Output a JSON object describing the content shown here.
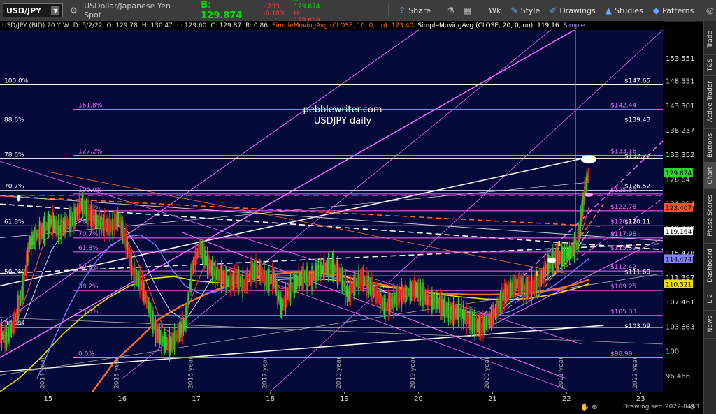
{
  "toolbar": {
    "symbol": "USD/JPY",
    "description": "USDollar/Japanese Yen Spot",
    "bid": "B: 129.874",
    "change_abs": "-.233",
    "change_pct": "-0.18%",
    "ask": "A: 129.874",
    "high_small": "H: 129.889",
    "buttons": {
      "share": "Share",
      "timeframe": "Wk",
      "style": "Style",
      "drawings": "Drawings",
      "studies": "Studies",
      "patterns": "Patterns"
    }
  },
  "infobar": {
    "symbol": "USD/JPY (BID) 20 Y W",
    "date": "D: 5/2/22",
    "open": "O: 129.78",
    "high": "H: 130.47",
    "low": "L: 129.60",
    "close": "C: 129.87",
    "range": "R: 0.86",
    "sma1": "SimpleMovingAvg (CLOSE, 10, 0, no)",
    "sma1_val": "123.40",
    "sma2": "SimpleMovingAvg (CLOSE, 20, 0, no)",
    "sma2_val": "119.16",
    "sma3": "Simple..."
  },
  "side_tabs": [
    "Trade",
    "T&S",
    "Active Trader",
    "Buttons",
    "Chart",
    "Phase Scores",
    "Dashboard",
    "L 2",
    "News"
  ],
  "statusbar": {
    "drawing_set": "Drawing set: 2022-0418"
  },
  "watermark": {
    "line1": "pebblewriter.com",
    "line2": "USDJPY daily"
  },
  "colors": {
    "background": "#050a3a",
    "fib_magenta": "#ff66ff",
    "white": "#ffffff",
    "orange": "#ff6a2a",
    "sma_yellow": "#e8e000",
    "sma_blue": "#7a7aff",
    "price_green": "#2fd02f",
    "price_red": "#e02020"
  },
  "chart_data": {
    "type": "line",
    "title": "USD/JPY (BID) 20 Y W",
    "x_ticks": [
      "15",
      "16",
      "17",
      "18",
      "19",
      "20",
      "21",
      "22",
      "23"
    ],
    "year_labels": [
      "2014 year",
      "2015 year",
      "2016 year",
      "2017 year",
      "2018 year",
      "2019 year",
      "2020 year",
      "2021 year",
      "2022 year"
    ],
    "y_ticks": [
      "153.551",
      "148.551",
      "143.301",
      "138.237",
      "133.352",
      "128.64",
      "124.094",
      "119.708",
      "115.478",
      "111.397",
      "107.461",
      "103.663",
      "100",
      "96.466"
    ],
    "ylim": [
      94.2,
      160
    ],
    "xlim": [
      14.35,
      23.3
    ],
    "scale": "log",
    "price_labels": [
      {
        "text": "129.874",
        "value": 129.874,
        "color": "#2fd02f"
      },
      {
        "text": "123.407",
        "value": 123.407,
        "color": "#ff5030"
      },
      {
        "text": "119.164",
        "value": 119.164,
        "color": "#ffffff"
      },
      {
        "text": "114.474",
        "value": 114.474,
        "color": "#8080ff"
      },
      {
        "text": "110.321",
        "value": 110.321,
        "color": "#e8e000"
      }
    ],
    "left_fib_levels": [
      {
        "label": "100.0%",
        "value": 147.65
      },
      {
        "label": "88.6%",
        "value": 139.43
      },
      {
        "label": "78.6%",
        "value": 132.5
      },
      {
        "label": "70.7%",
        "value": 126.5
      },
      {
        "label": "61.8%",
        "value": 120.11
      },
      {
        "label": "50.0%",
        "value": 111.6
      },
      {
        "label": "38.2%",
        "value": 103.5
      }
    ],
    "right_fib_levels": [
      {
        "label": "161.8%",
        "pct_value": 142.44,
        "value_text": "$142.44"
      },
      {
        "label": "127.2%",
        "pct_value": 133.16,
        "value_text": "$133.16"
      },
      {
        "label": "100.0%",
        "pct_value": 125.84,
        "value_text": "$125.84"
      },
      {
        "label": "88.6%",
        "pct_value": 122.78,
        "value_text": "$122.78"
      },
      {
        "label": "78.6%",
        "pct_value": 120.11,
        "value_text": "$120.11"
      },
      {
        "label": "70.7%",
        "pct_value": 117.98,
        "value_text": "$117.98"
      },
      {
        "label": "61.8%",
        "pct_value": 115.59,
        "value_text": "$115.59"
      },
      {
        "label": "50.0%",
        "pct_value": 112.42,
        "value_text": "$112.42"
      },
      {
        "label": "38.2%",
        "pct_value": 109.25,
        "value_text": "$109.25"
      },
      {
        "label": "23.6%",
        "pct_value": 105.33,
        "value_text": "$105.33"
      },
      {
        "label": "0.0%",
        "pct_value": 98.99,
        "value_text": "$98.99"
      }
    ],
    "white_level_labels": [
      {
        "text": "$147.65",
        "value": 147.65
      },
      {
        "text": "$139.43",
        "value": 139.43
      },
      {
        "text": "$132.22",
        "value": 132.22
      },
      {
        "text": "$126.52",
        "value": 126.52
      },
      {
        "text": "$120.11",
        "value": 120.11
      },
      {
        "text": "$111.60",
        "value": 111.6
      },
      {
        "text": "$103.09",
        "value": 103.09
      }
    ],
    "price_series": [
      [
        14.35,
        102.5
      ],
      [
        14.45,
        101.8
      ],
      [
        14.55,
        104.5
      ],
      [
        14.65,
        109
      ],
      [
        14.75,
        117
      ],
      [
        14.85,
        118.5
      ],
      [
        14.95,
        119.5
      ],
      [
        15.05,
        121
      ],
      [
        15.15,
        119.3
      ],
      [
        15.25,
        120.5
      ],
      [
        15.35,
        121.5
      ],
      [
        15.45,
        124
      ],
      [
        15.55,
        122.2
      ],
      [
        15.65,
        121
      ],
      [
        15.75,
        120.3
      ],
      [
        15.85,
        119.8
      ],
      [
        15.95,
        121.5
      ],
      [
        16.05,
        117.5
      ],
      [
        16.15,
        112
      ],
      [
        16.25,
        110.5
      ],
      [
        16.35,
        107
      ],
      [
        16.45,
        103
      ],
      [
        16.55,
        101.5
      ],
      [
        16.65,
        100.8
      ],
      [
        16.75,
        102.5
      ],
      [
        16.85,
        104
      ],
      [
        16.95,
        113
      ],
      [
        17.05,
        116.5
      ],
      [
        17.15,
        113.8
      ],
      [
        17.25,
        112
      ],
      [
        17.35,
        111.5
      ],
      [
        17.45,
        110.5
      ],
      [
        17.55,
        111.2
      ],
      [
        17.65,
        110
      ],
      [
        17.75,
        112.5
      ],
      [
        17.85,
        112.5
      ],
      [
        17.95,
        110.8
      ],
      [
        18.05,
        111.2
      ],
      [
        18.15,
        106.5
      ],
      [
        18.25,
        109
      ],
      [
        18.35,
        110.5
      ],
      [
        18.45,
        111.5
      ],
      [
        18.55,
        111
      ],
      [
        18.65,
        112.5
      ],
      [
        18.75,
        113
      ],
      [
        18.85,
        113.2
      ],
      [
        18.95,
        111.5
      ],
      [
        19.05,
        108.5
      ],
      [
        19.15,
        110.5
      ],
      [
        19.25,
        111.2
      ],
      [
        19.35,
        109.8
      ],
      [
        19.45,
        108.5
      ],
      [
        19.55,
        106.5
      ],
      [
        19.65,
        107.5
      ],
      [
        19.75,
        108.5
      ],
      [
        19.85,
        108.8
      ],
      [
        19.95,
        109.5
      ],
      [
        20.05,
        108.8
      ],
      [
        20.15,
        107.5
      ],
      [
        20.25,
        107.5
      ],
      [
        20.35,
        106.5
      ],
      [
        20.45,
        105.5
      ],
      [
        20.55,
        106
      ],
      [
        20.65,
        105
      ],
      [
        20.75,
        104
      ],
      [
        20.85,
        103.5
      ],
      [
        20.95,
        104.5
      ],
      [
        21.05,
        106
      ],
      [
        21.15,
        108.5
      ],
      [
        21.25,
        109.5
      ],
      [
        21.35,
        110.5
      ],
      [
        21.45,
        109.5
      ],
      [
        21.55,
        110
      ],
      [
        21.65,
        111
      ],
      [
        21.75,
        113.5
      ],
      [
        21.85,
        114.5
      ],
      [
        21.95,
        114.8
      ],
      [
        22.05,
        115.5
      ],
      [
        22.15,
        117
      ],
      [
        22.2,
        122
      ],
      [
        22.25,
        126.5
      ],
      [
        22.3,
        129.87
      ]
    ],
    "sma10_series": [
      [
        14.35,
        103
      ],
      [
        14.55,
        103.5
      ],
      [
        14.75,
        110
      ],
      [
        14.95,
        117.5
      ],
      [
        15.15,
        120
      ],
      [
        15.35,
        120.5
      ],
      [
        15.55,
        122.5
      ],
      [
        15.75,
        121
      ],
      [
        15.95,
        120.5
      ],
      [
        16.15,
        115.5
      ],
      [
        16.35,
        110
      ],
      [
        16.55,
        103.5
      ],
      [
        16.75,
        102
      ],
      [
        16.95,
        108.5
      ],
      [
        17.15,
        114.5
      ],
      [
        17.35,
        112
      ],
      [
        17.55,
        111
      ],
      [
        17.75,
        111.2
      ],
      [
        17.95,
        111.6
      ],
      [
        18.15,
        109.5
      ],
      [
        18.35,
        110
      ],
      [
        18.55,
        111.2
      ],
      [
        18.75,
        112.6
      ],
      [
        18.95,
        112
      ],
      [
        19.15,
        109.8
      ],
      [
        19.35,
        110.5
      ],
      [
        19.55,
        107.8
      ],
      [
        19.75,
        108
      ],
      [
        19.95,
        109.2
      ],
      [
        20.15,
        108.3
      ],
      [
        20.35,
        107.2
      ],
      [
        20.55,
        105.8
      ],
      [
        20.75,
        104.8
      ],
      [
        20.95,
        104.5
      ],
      [
        21.15,
        107
      ],
      [
        21.35,
        109.8
      ],
      [
        21.55,
        110
      ],
      [
        21.75,
        112
      ],
      [
        21.95,
        114.3
      ],
      [
        22.15,
        116.5
      ],
      [
        22.3,
        123.4
      ]
    ],
    "sma20_series": [
      [
        14.35,
        103.8
      ],
      [
        14.65,
        104
      ],
      [
        14.85,
        110
      ],
      [
        15.05,
        116
      ],
      [
        15.25,
        119.5
      ],
      [
        15.45,
        121
      ],
      [
        15.65,
        121.8
      ],
      [
        15.85,
        121
      ],
      [
        16.05,
        119.5
      ],
      [
        16.25,
        115.5
      ],
      [
        16.45,
        110
      ],
      [
        16.65,
        106
      ],
      [
        16.85,
        104.5
      ],
      [
        17.05,
        108
      ],
      [
        17.25,
        112
      ],
      [
        17.45,
        112.6
      ],
      [
        17.65,
        111.6
      ],
      [
        17.85,
        111.4
      ],
      [
        18.05,
        111.2
      ],
      [
        18.25,
        110.2
      ],
      [
        18.45,
        110.8
      ],
      [
        18.65,
        111.8
      ],
      [
        18.85,
        112.3
      ],
      [
        19.05,
        111.4
      ],
      [
        19.25,
        110.2
      ],
      [
        19.45,
        109.6
      ],
      [
        19.65,
        108.5
      ],
      [
        19.85,
        108.6
      ],
      [
        20.05,
        108.8
      ],
      [
        20.25,
        108.2
      ],
      [
        20.45,
        106.8
      ],
      [
        20.65,
        105.9
      ],
      [
        20.85,
        105
      ],
      [
        21.05,
        105.5
      ],
      [
        21.25,
        107.5
      ],
      [
        21.45,
        108.8
      ],
      [
        21.65,
        110.4
      ],
      [
        21.85,
        112
      ],
      [
        22.05,
        114.5
      ],
      [
        22.3,
        119.16
      ]
    ],
    "sma50_series": [
      [
        14.85,
        96
      ],
      [
        15.05,
        101
      ],
      [
        15.25,
        106
      ],
      [
        15.45,
        110.5
      ],
      [
        15.65,
        114
      ],
      [
        15.85,
        116.8
      ],
      [
        16.05,
        118.2
      ],
      [
        16.25,
        118.5
      ],
      [
        16.45,
        116.8
      ],
      [
        16.65,
        113
      ],
      [
        16.85,
        110
      ],
      [
        17.05,
        108.8
      ],
      [
        17.25,
        109
      ],
      [
        17.45,
        110
      ],
      [
        17.65,
        110.8
      ],
      [
        17.85,
        111.2
      ],
      [
        18.05,
        111.4
      ],
      [
        18.25,
        111.3
      ],
      [
        18.45,
        111.5
      ],
      [
        18.65,
        111.6
      ],
      [
        18.85,
        111.4
      ],
      [
        19.05,
        110.5
      ],
      [
        19.25,
        109.6
      ],
      [
        19.45,
        109.2
      ],
      [
        19.65,
        108.8
      ],
      [
        19.85,
        108.7
      ],
      [
        20.05,
        108.2
      ],
      [
        20.25,
        107.4
      ],
      [
        20.45,
        106.6
      ],
      [
        20.65,
        106
      ],
      [
        20.85,
        105.6
      ],
      [
        21.05,
        105.3
      ],
      [
        21.25,
        106
      ],
      [
        21.45,
        107.2
      ],
      [
        21.65,
        108.8
      ],
      [
        21.85,
        110.2
      ],
      [
        22.05,
        112
      ],
      [
        22.3,
        114.47
      ]
    ],
    "sma100_series": [
      [
        14.35,
        94.2
      ],
      [
        14.6,
        96
      ],
      [
        14.9,
        99
      ],
      [
        15.2,
        102.5
      ],
      [
        15.5,
        105.5
      ],
      [
        15.8,
        108
      ],
      [
        16.1,
        110
      ],
      [
        16.4,
        111.2
      ],
      [
        16.7,
        111.5
      ],
      [
        17.0,
        110.8
      ],
      [
        17.3,
        110.5
      ],
      [
        17.6,
        110.6
      ],
      [
        17.9,
        110.9
      ],
      [
        18.2,
        111.1
      ],
      [
        18.5,
        111.2
      ],
      [
        18.8,
        111
      ],
      [
        19.1,
        110.6
      ],
      [
        19.4,
        110.1
      ],
      [
        19.7,
        109.6
      ],
      [
        20.0,
        109.1
      ],
      [
        20.3,
        108.6
      ],
      [
        20.6,
        108.2
      ],
      [
        20.9,
        107.9
      ],
      [
        21.2,
        107.8
      ],
      [
        21.5,
        108
      ],
      [
        21.8,
        108.6
      ],
      [
        22.1,
        109.5
      ],
      [
        22.3,
        110.32
      ]
    ],
    "sma200_series": [
      [
        15.6,
        94.2
      ],
      [
        15.9,
        98.5
      ],
      [
        16.2,
        101.5
      ],
      [
        16.5,
        104.8
      ],
      [
        16.8,
        106.8
      ],
      [
        17.1,
        108.5
      ],
      [
        17.4,
        110
      ],
      [
        17.7,
        111
      ],
      [
        18.0,
        111.8
      ],
      [
        18.3,
        112.2
      ],
      [
        18.6,
        112.1
      ],
      [
        18.9,
        111.7
      ],
      [
        19.2,
        111
      ],
      [
        19.5,
        110.2
      ],
      [
        19.8,
        109.5
      ],
      [
        20.1,
        109
      ],
      [
        20.4,
        108.7
      ],
      [
        20.7,
        108.6
      ],
      [
        21.0,
        108.6
      ],
      [
        21.3,
        108.7
      ],
      [
        21.6,
        109
      ],
      [
        21.9,
        109.6
      ],
      [
        22.1,
        110.2
      ],
      [
        22.3,
        111
      ]
    ]
  }
}
